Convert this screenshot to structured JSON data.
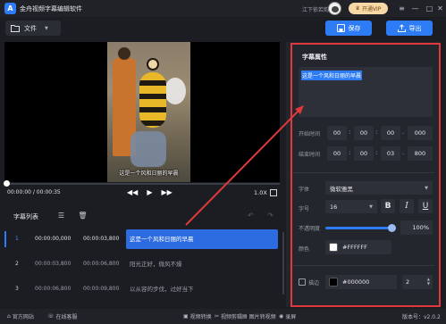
{
  "app": {
    "title": "金舟视频字幕编辑软件",
    "user_name": "江下依若韵",
    "vip_label": "开通VIP",
    "logo_letter": "A"
  },
  "toolbar": {
    "file_label": "文件",
    "save_label": "保存",
    "export_label": "导出"
  },
  "player": {
    "subtitle_overlay": "这是一个风和日丽的早晨",
    "time": "00:00:00 / 00:00:35",
    "speed": "1.0X"
  },
  "subtitle_list": {
    "title": "字幕列表",
    "rows": [
      {
        "index": "1",
        "start": "00:00:00,000",
        "end": "00:00:03,800",
        "text": "这是一个风和日丽的早晨",
        "active": true
      },
      {
        "index": "2",
        "start": "00:00:03,800",
        "end": "00:00:06,800",
        "text": "阳光正好，微风不燥",
        "active": false
      },
      {
        "index": "3",
        "start": "00:00:06,800",
        "end": "00:00:09,800",
        "text": "以从容的步伐，过好当下",
        "active": false
      }
    ]
  },
  "properties": {
    "title": "字幕属性",
    "text_value": "这是一个风和日丽的早晨",
    "start_label": "开始时间",
    "start_time": [
      "00",
      "00",
      "00",
      "000"
    ],
    "end_label": "结束时间",
    "end_time": [
      "00",
      "00",
      "03",
      "800"
    ],
    "font_label": "字体",
    "font_value": "微软雅黑",
    "size_label": "字号",
    "size_value": "16",
    "bold": "B",
    "italic": "I",
    "underline": "U",
    "opacity_label": "不透明度",
    "opacity_value": "100%",
    "opacity": 1.0,
    "color_label": "颜色",
    "color_value": "#FFFFFF",
    "stroke_label": "描边",
    "stroke_color": "#000000",
    "stroke_width": "2"
  },
  "bottombar": {
    "official_site": "官方网站",
    "online_service": "在线客服",
    "video_convert": "视频转换",
    "video_edit": "视频剪辑",
    "image_convert": "图片转视频",
    "record": "录屏",
    "version": "版本号：v2.0.2"
  },
  "colors": {
    "accent": "#2d7cf6",
    "annotation": "#e0393b"
  }
}
